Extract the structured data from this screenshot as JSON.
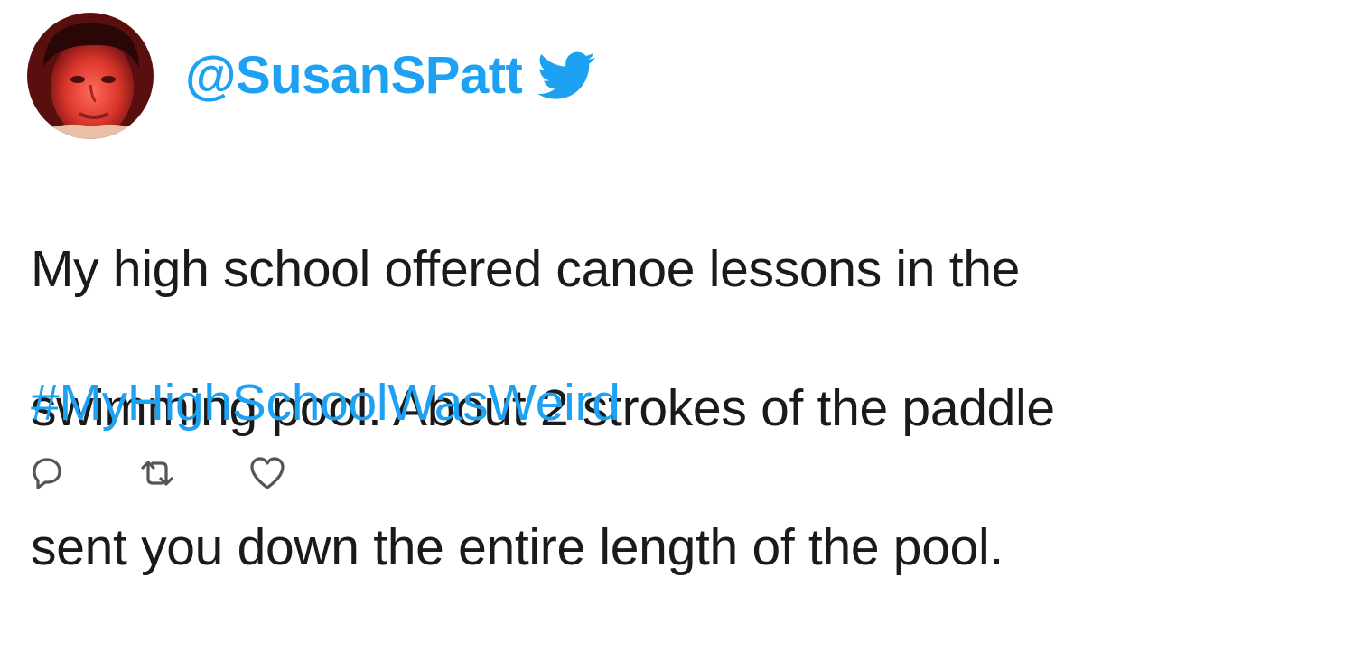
{
  "tweet": {
    "handle": "@SusanSPatt",
    "text_lines": [
      "My high school offered canoe lessons in the",
      "swimming pool. About 2 strokes of the paddle",
      "sent you down the entire length of the pool."
    ],
    "hashtag": "#MyHighSchoolWasWeird"
  },
  "icons": {
    "platform": "twitter-bird-icon",
    "actions": [
      "reply-icon",
      "retweet-icon",
      "like-icon"
    ]
  },
  "colors": {
    "accent": "#1da1f2",
    "text": "#1a1a1a",
    "icon": "#555555"
  }
}
